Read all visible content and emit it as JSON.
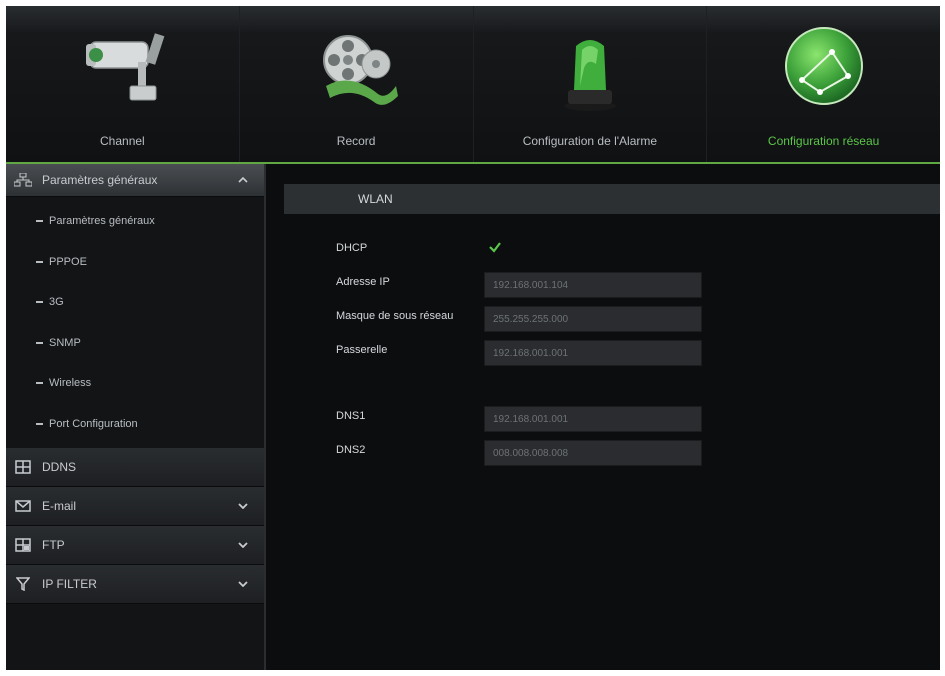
{
  "topnav": {
    "tabs": [
      {
        "label": "Channel",
        "icon": "camera-icon"
      },
      {
        "label": "Record",
        "icon": "film-reel-icon"
      },
      {
        "label": "Configuration de l'Alarme",
        "icon": "alarm-light-icon"
      },
      {
        "label": "Configuration réseau",
        "icon": "network-globe-icon",
        "active": true
      }
    ]
  },
  "sidebar": {
    "expanded_section": {
      "label": "Paramètres généraux",
      "icon": "network-icon",
      "items": [
        {
          "label": "Paramètres généraux"
        },
        {
          "label": "PPPOE"
        },
        {
          "label": "3G"
        },
        {
          "label": "SNMP"
        },
        {
          "label": "Wireless"
        },
        {
          "label": "Port Configuration"
        }
      ]
    },
    "sections": [
      {
        "label": "DDNS",
        "icon": "ddns-icon",
        "chevron": false
      },
      {
        "label": "E-mail",
        "icon": "envelope-icon",
        "chevron": true
      },
      {
        "label": "FTP",
        "icon": "ftp-icon",
        "chevron": true
      },
      {
        "label": "IP FILTER",
        "icon": "filter-icon",
        "chevron": true
      }
    ]
  },
  "main": {
    "header": "WLAN",
    "dhcp": {
      "label": "DHCP",
      "checked": true
    },
    "fields": {
      "ip": {
        "label": "Adresse IP",
        "value": "192.168.001.104"
      },
      "mask": {
        "label": "Masque de sous réseau",
        "value": "255.255.255.000"
      },
      "gateway": {
        "label": "Passerelle",
        "value": "192.168.001.001"
      },
      "dns1": {
        "label": "DNS1",
        "value": "192.168.001.001"
      },
      "dns2": {
        "label": "DNS2",
        "value": "008.008.008.008"
      }
    }
  },
  "colors": {
    "accent": "#5cc64a",
    "background": "#0b0d0f"
  }
}
